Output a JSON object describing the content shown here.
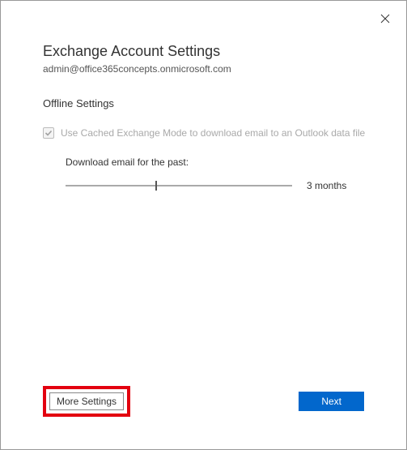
{
  "header": {
    "title": "Exchange Account Settings",
    "email": "admin@office365concepts.onmicrosoft.com"
  },
  "offline": {
    "section_label": "Offline Settings",
    "checkbox_label": "Use Cached Exchange Mode to download email to an Outlook data file",
    "checkbox_checked": true,
    "checkbox_disabled": true,
    "slider_label": "Download email for the past:",
    "slider_value_label": "3 months"
  },
  "footer": {
    "more_settings_label": "More Settings",
    "next_label": "Next"
  },
  "colors": {
    "highlight_border": "#e3000f",
    "primary_button": "#0267cc",
    "disabled_text": "#a9a9a9"
  }
}
